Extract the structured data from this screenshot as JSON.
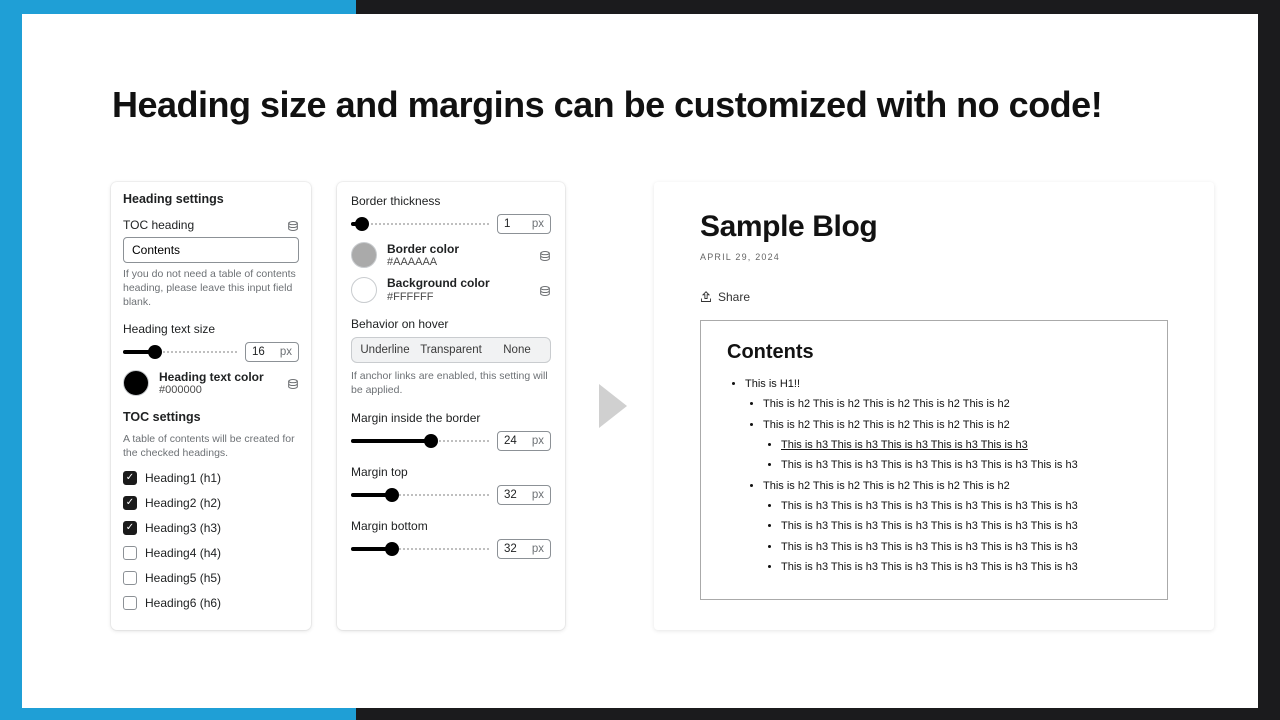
{
  "headline": "Heading size and margins can be customized with no code!",
  "left_panel": {
    "heading_settings_title": "Heading settings",
    "toc_heading_label": "TOC heading",
    "toc_heading_value": "Contents",
    "toc_heading_help": "If you do not need a table of contents heading, please leave this input field blank.",
    "heading_text_size_label": "Heading text size",
    "heading_text_size_value": "16",
    "unit": "px",
    "heading_text_color": {
      "label": "Heading text color",
      "hex": "#000000"
    },
    "toc_settings_title": "TOC settings",
    "toc_settings_help": "A table of contents will be created for the checked headings.",
    "headings": [
      {
        "label": "Heading1 (h1)",
        "checked": true
      },
      {
        "label": "Heading2 (h2)",
        "checked": true
      },
      {
        "label": "Heading3 (h3)",
        "checked": true
      },
      {
        "label": "Heading4 (h4)",
        "checked": false
      },
      {
        "label": "Heading5 (h5)",
        "checked": false
      },
      {
        "label": "Heading6 (h6)",
        "checked": false
      }
    ]
  },
  "mid_panel": {
    "border_thickness_label": "Border thickness",
    "border_thickness_value": "1",
    "unit": "px",
    "border_color": {
      "label": "Border color",
      "hex": "#AAAAAA"
    },
    "background_color": {
      "label": "Background color",
      "hex": "#FFFFFF"
    },
    "behavior_label": "Behavior on hover",
    "behavior_options": [
      "Underline",
      "Transparent",
      "None"
    ],
    "behavior_help": "If anchor links are enabled, this setting will be applied.",
    "margin_inside_label": "Margin inside the border",
    "margin_inside_value": "24",
    "margin_top_label": "Margin top",
    "margin_top_value": "32",
    "margin_bottom_label": "Margin bottom",
    "margin_bottom_value": "32"
  },
  "preview": {
    "title": "Sample Blog",
    "date": "APRIL 29, 2024",
    "share_label": "Share",
    "toc_heading": "Contents",
    "items": {
      "h1": "This is H1!!",
      "h2a": "This is h2 This is h2 This is h2 This is h2 This is h2",
      "h2b": "This is h2 This is h2 This is h2 This is h2 This is h2",
      "h3a": "This is h3 This is h3 This is h3 This is h3 This is h3",
      "h3b": "This is h3 This is h3 This is h3 This is h3 This is h3 This is h3",
      "h2c": "This is h2 This is h2 This is h2 This is h2 This is h2",
      "h3c": "This is h3 This is h3 This is h3 This is h3 This is h3 This is h3",
      "h3d": "This is h3 This is h3 This is h3 This is h3 This is h3 This is h3",
      "h3e": "This is h3 This is h3 This is h3 This is h3 This is h3 This is h3",
      "h3f": "This is h3 This is h3 This is h3 This is h3 This is h3 This is h3"
    }
  }
}
